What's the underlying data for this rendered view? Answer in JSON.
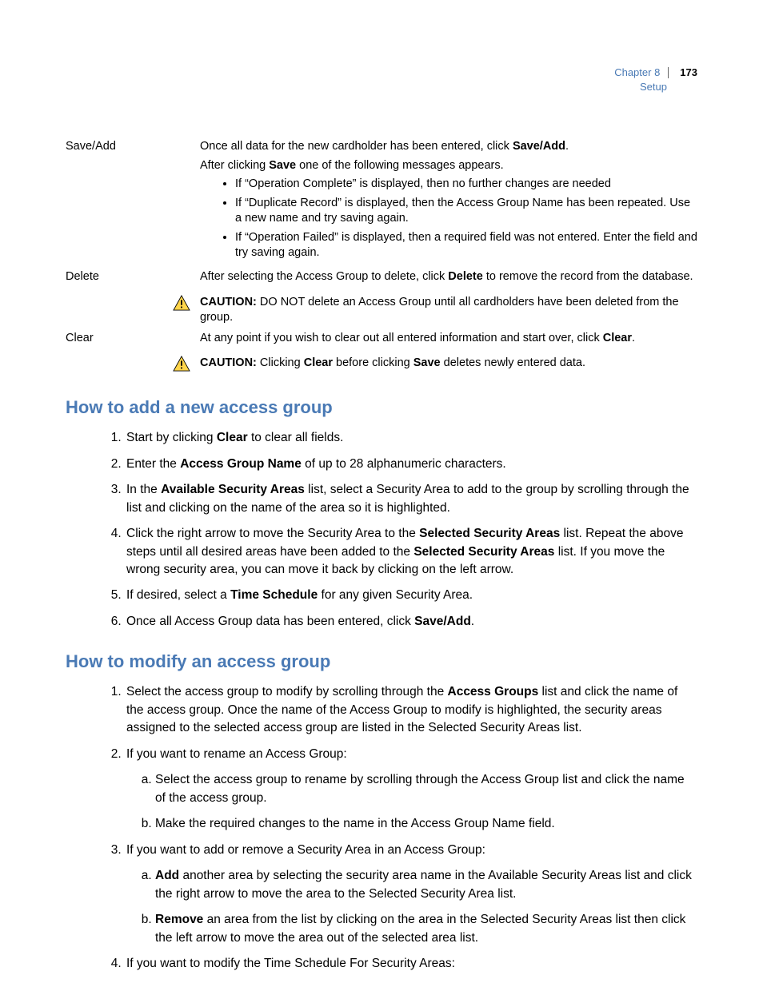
{
  "header": {
    "chapter": "Chapter 8",
    "page": "173",
    "section": "Setup"
  },
  "defs": {
    "saveAdd": {
      "term": "Save/Add",
      "p1_a": "Once all data for the new cardholder has been entered, click ",
      "p1_b": "Save/Add",
      "p1_c": ".",
      "p2_a": "After clicking ",
      "p2_b": "Save",
      "p2_c": " one of the following messages appears.",
      "li1": "If “Operation Complete” is displayed, then no further changes are needed",
      "li2": "If “Duplicate Record” is displayed, then the Access Group Name has been repeated. Use a new name and try saving again.",
      "li3": "If “Operation Failed” is displayed, then a required field was not entered. Enter the field and try saving again."
    },
    "delete": {
      "term": "Delete",
      "p_a": "After selecting the Access Group to delete, click ",
      "p_b": "Delete",
      "p_c": " to remove the record from the database."
    },
    "caution1": {
      "label": "CAUTION:",
      "text": "  DO NOT delete an Access Group until all cardholders have been deleted from the group."
    },
    "clear": {
      "term": "Clear",
      "p_a": "At any point if you wish to clear out all entered information and start over, click ",
      "p_b": "Clear",
      "p_c": "."
    },
    "caution2": {
      "label": "CAUTION:",
      "text_a": "  Clicking ",
      "text_b": "Clear",
      "text_c": " before clicking ",
      "text_d": "Save",
      "text_e": " deletes newly entered data."
    }
  },
  "h_add": "How to add a new access group",
  "add": {
    "i1_a": "Start by clicking ",
    "i1_b": "Clear",
    "i1_c": " to clear all fields.",
    "i2_a": "Enter the ",
    "i2_b": "Access Group Name",
    "i2_c": " of up to 28 alphanumeric characters.",
    "i3_a": "In the ",
    "i3_b": "Available Security Areas",
    "i3_c": " list, select a Security Area to add to the group by scrolling through the list and clicking on the name of the area so it is highlighted.",
    "i4_a": "Click the right arrow to move the Security Area to the ",
    "i4_b": "Selected Security Areas",
    "i4_c": " list. Repeat the above steps until all desired areas have been added to the ",
    "i4_d": "Selected Security Areas",
    "i4_e": " list. If you move the wrong security area, you can move it back by clicking on the left arrow.",
    "i5_a": "If desired, select a ",
    "i5_b": "Time Schedule",
    "i5_c": " for any given Security Area.",
    "i6_a": "Once all Access Group data has been entered, click ",
    "i6_b": "Save/Add",
    "i6_c": "."
  },
  "h_mod": "How to modify an access group",
  "mod": {
    "i1_a": "Select the access group to modify by scrolling through the ",
    "i1_b": "Access Groups",
    "i1_c": " list and click the name of the access group. Once the name of the Access Group to modify is highlighted, the security areas assigned to the selected access group are listed in the Selected Security Areas list.",
    "i2": "If you want to rename an Access Group:",
    "i2a": "Select the access group to rename by scrolling through the Access Group list and click the name of the access group.",
    "i2b": "Make the required changes to the name in the Access Group Name field.",
    "i3": "If you want to add or remove a Security Area in an Access Group:",
    "i3a_b": "Add",
    "i3a_t": " another area by selecting the security area name in the Available Security Areas list and click the right arrow to move the area to the Selected Security Area list.",
    "i3b_b": "Remove",
    "i3b_t": " an area from the list by clicking on the area in the Selected Security Areas list then click the left arrow to move the area out of the selected area list.",
    "i4": "If you want to modify the Time Schedule For Security Areas:"
  }
}
